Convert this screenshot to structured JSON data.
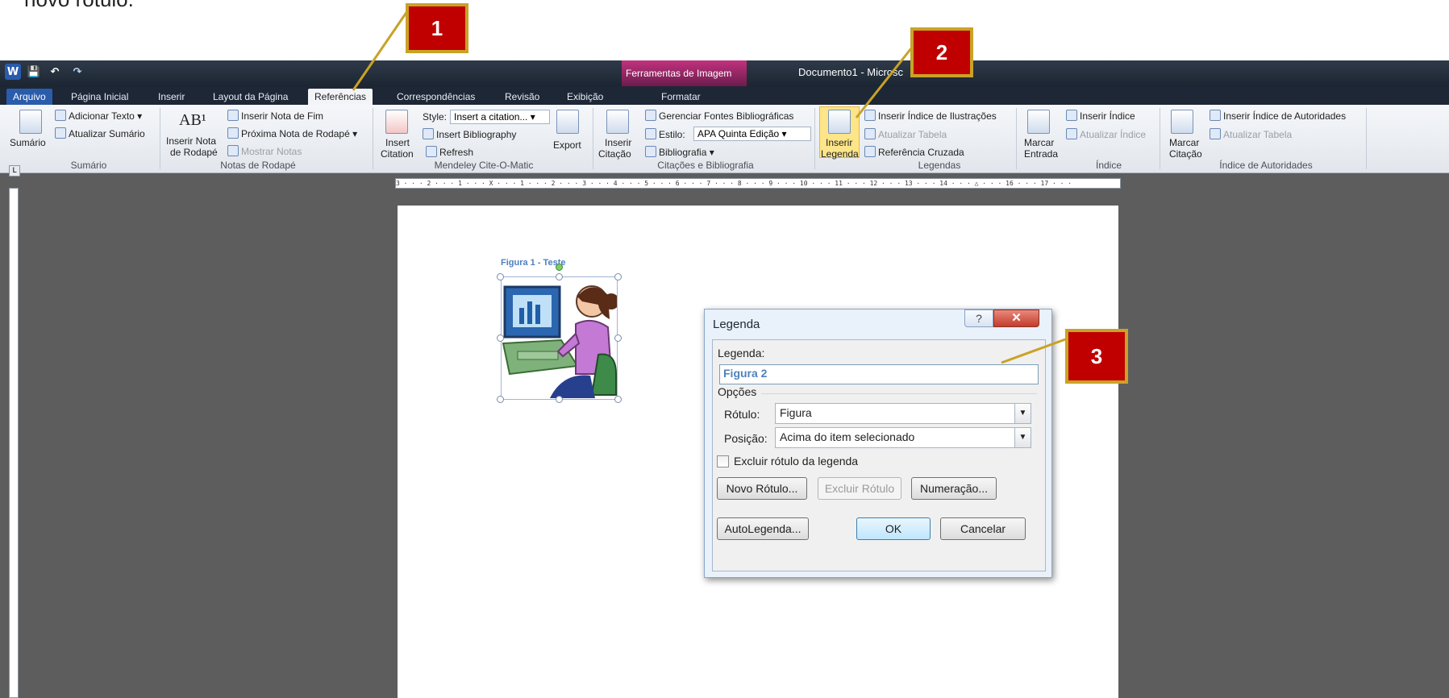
{
  "caption_fragment": "novo rótulo.",
  "titlebar": {
    "quick_access": {
      "save": "💾",
      "undo": "↶",
      "redo": "↷"
    },
    "tools_context": "Ferramentas de Imagem",
    "document_title": "Documento1 - Microsc"
  },
  "tabs": [
    "Arquivo",
    "Página Inicial",
    "Inserir",
    "Layout da Página",
    "Referências",
    "Correspondências",
    "Revisão",
    "Exibição",
    "Formatar"
  ],
  "ribbon": {
    "sumario": {
      "big_button": "Sumário",
      "add_text": "Adicionar Texto",
      "update": "Atualizar Sumário",
      "group": "Sumário"
    },
    "notas": {
      "insert_note_line1": "Inserir Nota",
      "insert_note_line2": "de Rodapé",
      "endnote": "Inserir Nota de Fim",
      "next_note": "Próxima Nota de Rodapé",
      "show_notes": "Mostrar Notas",
      "group": "Notas de Rodapé"
    },
    "mendeley": {
      "insert_citation_line1": "Insert",
      "insert_citation_line2": "Citation",
      "style_label": "Style:",
      "style_value": "Insert a citation...",
      "insert_bibliography": "Insert Bibliography",
      "refresh": "Refresh",
      "export": "Export",
      "group": "Mendeley Cite-O-Matic"
    },
    "citacoes": {
      "insert_line1": "Inserir",
      "insert_line2": "Citação",
      "manage_sources": "Gerenciar Fontes Bibliográficas",
      "style_label": "Estilo:",
      "style_value": "APA Quinta Edição",
      "bibliography": "Bibliografia",
      "group": "Citações e Bibliografia"
    },
    "legendas": {
      "insert_line1": "Inserir",
      "insert_line2": "Legenda",
      "insert_index_illustrations": "Inserir Índice de Ilustrações",
      "update_table": "Atualizar Tabela",
      "cross_reference": "Referência Cruzada",
      "group": "Legendas"
    },
    "indice": {
      "mark_line1": "Marcar",
      "mark_line2": "Entrada",
      "insert_index": "Inserir Índice",
      "update_index": "Atualizar Índice",
      "group": "Índice"
    },
    "autoridades": {
      "mark_line1": "Marcar",
      "mark_line2": "Citação",
      "insert_index": "Inserir Índice de Autoridades",
      "update_table": "Atualizar Tabela",
      "group": "Índice de Autoridades"
    }
  },
  "ruler": {
    "corner": "L",
    "horizontal_ticks": "3 · · · 2 · · · 1 · · · X · · · 1 · · · 2 · · · 3 · · · 4 · · · 5 · · · 6 · · · 7 · · · 8 · · · 9 · · · 10 · · · 11 · · · 12 · · · 13 · · · 14 · · · △ · · · 16 · · · 17 · · ·"
  },
  "document": {
    "figure_caption": "Figura 1 - Teste"
  },
  "dialog": {
    "title": "Legenda",
    "help": "?",
    "close": "✕",
    "legenda_label": "Legenda:",
    "legenda_value": "Figura 2",
    "options_label": "Opções",
    "rotulo_label": "Rótulo:",
    "rotulo_value": "Figura",
    "posicao_label": "Posição:",
    "posicao_value": "Acima do item selecionado",
    "exclude_label": "Excluir rótulo da legenda",
    "new_label_button": "Novo Rótulo...",
    "delete_label_button": "Excluir Rótulo",
    "numbering_button": "Numeração...",
    "autocaption_button": "AutoLegenda...",
    "ok_button": "OK",
    "cancel_button": "Cancelar"
  },
  "callouts": {
    "one": "1",
    "two": "2",
    "three": "3"
  },
  "colors": {
    "callout_fill": "#c00000",
    "callout_border": "#c9a227",
    "active_tab": "#f2f4f7",
    "file_tab": "#2a5cac",
    "caption_blue": "#4f81bd"
  }
}
